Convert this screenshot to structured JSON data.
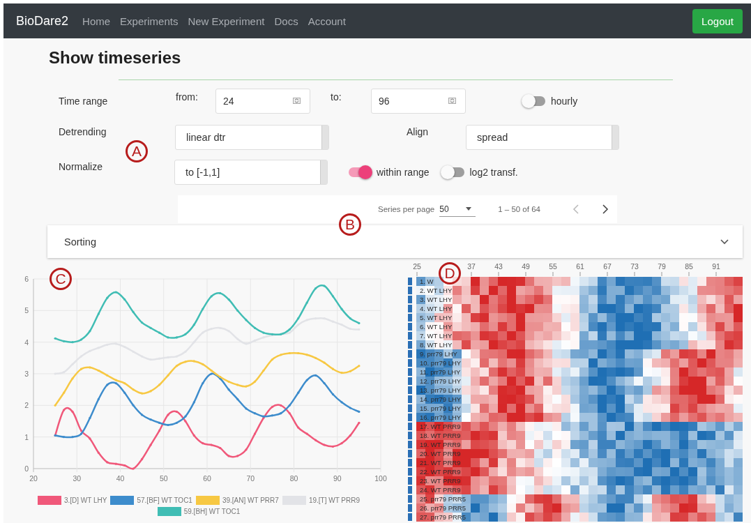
{
  "navbar": {
    "brand": "BioDare2",
    "links": [
      "Home",
      "Experiments",
      "New Experiment",
      "Docs",
      "Account"
    ],
    "logout": "Logout"
  },
  "page_title": "Show timeseries",
  "form": {
    "time_range": {
      "label": "Time range",
      "from_label": "from:",
      "from_value": "24",
      "to_label": "to:",
      "to_value": "96"
    },
    "hourly": {
      "label": "hourly",
      "on": false
    },
    "detrending": {
      "label": "Detrending",
      "value": "linear dtr"
    },
    "align": {
      "label": "Align",
      "value": "spread"
    },
    "normalize": {
      "label": "Normalize",
      "value": "to [-1,1]"
    },
    "within_range": {
      "label": "within range",
      "on": true
    },
    "log2": {
      "label": "log2 transf.",
      "on": false
    }
  },
  "paginator": {
    "label": "Series per page",
    "page_size": "50",
    "range": "1 – 50 of 64",
    "previous_disabled": true,
    "next_disabled": false
  },
  "sorting": {
    "title": "Sorting",
    "expanded": false
  },
  "line_chart": {
    "chart_data": {
      "type": "line",
      "grid": true,
      "legend": true,
      "x": [
        25,
        27,
        29,
        31,
        33,
        35,
        37,
        39,
        41,
        43,
        45,
        47,
        49,
        51,
        53,
        55,
        57,
        59,
        61,
        63,
        65,
        67,
        69,
        71,
        73,
        75,
        77,
        79,
        81,
        83,
        85,
        87,
        89,
        91,
        93,
        95
      ],
      "xlim": [
        20,
        100
      ],
      "ylim": [
        0,
        6
      ],
      "xticks": [
        20,
        30,
        40,
        50,
        60,
        70,
        80,
        90,
        100
      ],
      "yticks": [
        0,
        1,
        2,
        3,
        4,
        5,
        6
      ],
      "series": [
        {
          "name": "3.[D] WT LHY",
          "color": "#f0587a",
          "values": [
            1.05,
            1.85,
            1.8,
            1.2,
            0.95,
            0.5,
            0.2,
            0.15,
            0.1,
            0.0,
            0.3,
            0.75,
            1.2,
            1.7,
            1.8,
            1.5,
            1.05,
            0.8,
            0.75,
            0.65,
            0.4,
            0.4,
            0.6,
            1.1,
            1.6,
            1.95,
            2.0,
            1.75,
            1.3,
            1.1,
            0.9,
            0.75,
            0.7,
            0.8,
            1.05,
            1.45
          ]
        },
        {
          "name": "57.[BF] WT TOC1",
          "color": "#3d8ccc",
          "values": [
            1.05,
            1.0,
            1.0,
            1.1,
            1.6,
            2.2,
            2.65,
            2.7,
            2.4,
            2.0,
            1.7,
            1.55,
            1.45,
            1.38,
            1.45,
            1.65,
            2.1,
            2.7,
            3.0,
            2.85,
            2.5,
            2.2,
            1.9,
            1.75,
            1.65,
            1.68,
            1.75,
            2.0,
            2.4,
            2.8,
            2.95,
            2.7,
            2.35,
            2.1,
            1.92,
            1.8
          ]
        },
        {
          "name": "39.[AN] WT PRR7",
          "color": "#f7c843",
          "values": [
            2.0,
            2.4,
            2.85,
            3.15,
            3.2,
            3.1,
            2.95,
            2.8,
            2.7,
            2.5,
            2.38,
            2.45,
            2.65,
            2.95,
            3.25,
            3.38,
            3.4,
            3.3,
            3.1,
            2.9,
            2.75,
            2.65,
            2.6,
            2.75,
            3.1,
            3.45,
            3.6,
            3.65,
            3.65,
            3.6,
            3.5,
            3.35,
            3.15,
            3.03,
            3.08,
            3.25
          ]
        },
        {
          "name": "19.[T] WT PRR9",
          "color": "#e2e3e7",
          "values": [
            3.0,
            3.05,
            3.3,
            3.55,
            3.72,
            3.82,
            3.92,
            3.95,
            3.85,
            3.7,
            3.55,
            3.45,
            3.48,
            3.52,
            3.55,
            3.7,
            4.0,
            4.3,
            4.42,
            4.45,
            4.35,
            4.1,
            3.95,
            4.05,
            4.15,
            4.22,
            4.25,
            4.3,
            4.55,
            4.7,
            4.75,
            4.75,
            4.65,
            4.55,
            4.42,
            4.4
          ]
        },
        {
          "name": "59.[BH] WT TOC1",
          "color": "#40bdb4",
          "values": [
            4.12,
            4.03,
            4.0,
            4.08,
            4.35,
            4.9,
            5.4,
            5.58,
            5.35,
            4.95,
            4.62,
            4.45,
            4.3,
            4.15,
            4.15,
            4.25,
            4.55,
            5.05,
            5.45,
            5.55,
            5.35,
            5.0,
            4.7,
            4.45,
            4.3,
            4.25,
            4.25,
            4.4,
            4.75,
            5.25,
            5.7,
            5.78,
            5.45,
            5.05,
            4.75,
            4.6
          ]
        }
      ]
    }
  },
  "heatmap": {
    "column_ticks": [
      "25",
      "37",
      "43",
      "49",
      "55",
      "61",
      "67",
      "73",
      "79",
      "85",
      "91"
    ],
    "row_labels": [
      "1. W",
      "2. WT LHY",
      "3. WT LHY",
      "4. WT LHY",
      "5. WT LHY",
      "6. WT LHY",
      "7. WT LHY",
      "8. WT LHY",
      "9. prr79 LHY",
      "10. prr79 LHY",
      "11. prr79 LHY",
      "12. prr79 LHY",
      "13. prr79 LHY",
      "14. prr79 LHY",
      "15. prr79 LHY",
      "16. prr79 LHY",
      "17. WT PRR9",
      "18. WT PRR9",
      "19. WT PRR9",
      "20. WT PRR9",
      "21. WT PRR9",
      "22. WT PRR9",
      "23. WT PRR9",
      "24. WT PRR9",
      "25. prr79 PRR5",
      "26. prr79 PRR5",
      "27. prr79 PRR5"
    ]
  },
  "annotations": [
    {
      "label": "A"
    },
    {
      "label": "B"
    },
    {
      "label": "C"
    },
    {
      "label": "D"
    }
  ]
}
